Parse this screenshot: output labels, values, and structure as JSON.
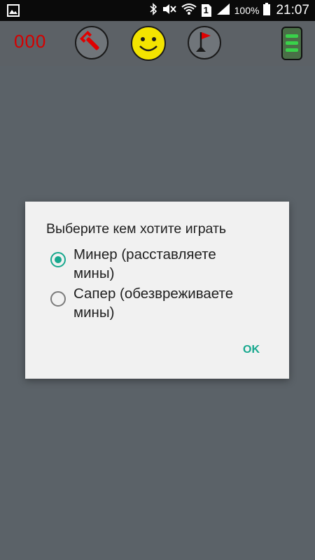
{
  "status_bar": {
    "battery_percent": "100%",
    "time": "21:07",
    "sim_slot": "1",
    "icons": [
      "gallery-notification-icon",
      "bluetooth-icon",
      "mute-icon",
      "wifi-icon",
      "sim-icon",
      "signal-icon",
      "battery-icon"
    ]
  },
  "toolbar": {
    "counter": "000",
    "icons": [
      "wrench-icon",
      "smiley-icon",
      "flag-icon",
      "menu-icon"
    ],
    "colors": {
      "counter": "#d40000",
      "smiley": "#f3e400",
      "menu": "#2e8a3a"
    }
  },
  "dialog": {
    "title": "Выберите кем хотите играть",
    "options": [
      {
        "label": "Минер (расставляете мины)",
        "selected": true
      },
      {
        "label": "Сапер (обезвреживаете мины)",
        "selected": false
      }
    ],
    "ok_label": "OK",
    "accent_color": "#17a88e"
  }
}
